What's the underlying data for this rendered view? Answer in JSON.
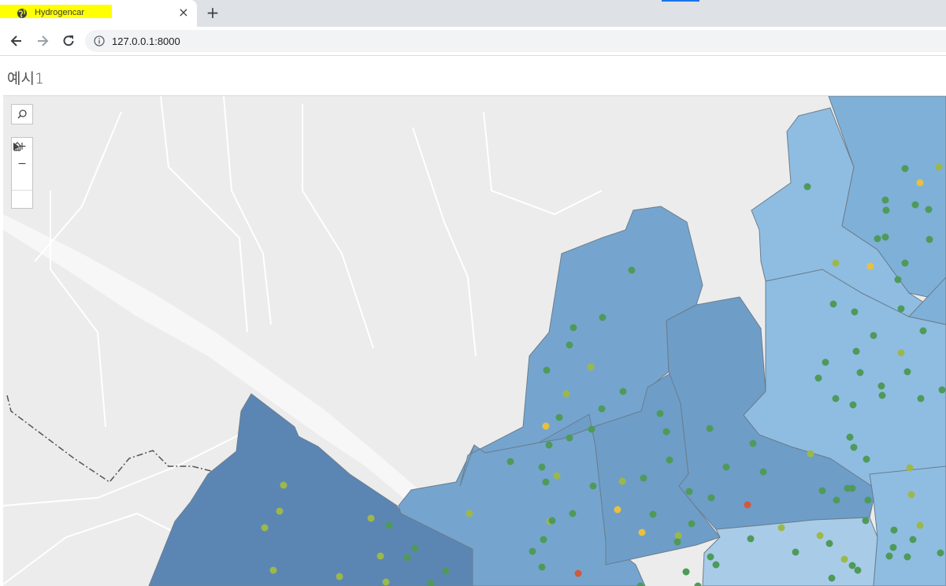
{
  "browser": {
    "tab_title": "Hydrogencar",
    "new_tab": "+",
    "url": "127.0.0.1:8000"
  },
  "page": {
    "heading": "예시1"
  },
  "map": {
    "controls": {
      "search": "search-icon",
      "zoom_in": "+",
      "zoom_out": "−",
      "home": "home-icon",
      "play": "play-icon"
    },
    "point_colors": {
      "green": "#4f9a5a",
      "olive": "#9cb84a",
      "yellow": "#e8c040",
      "orange": "#e8b040",
      "red": "#d05a3c"
    },
    "region_colors": [
      "#5b86b4",
      "#75a5cf",
      "#8fbde2",
      "#6e9dc8",
      "#a8cce8"
    ]
  }
}
